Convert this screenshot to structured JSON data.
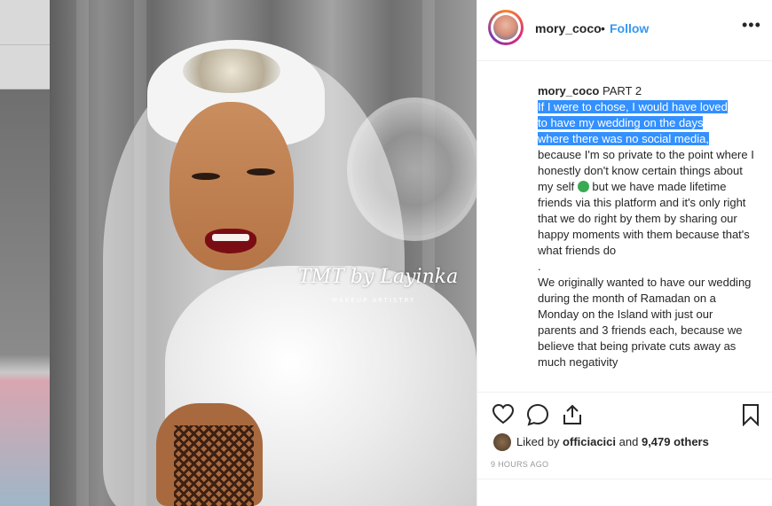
{
  "post": {
    "username": "mory_coco",
    "separator": "•",
    "follow_label": "Follow",
    "more_label": "•••",
    "caption": {
      "username": "mory_coco",
      "part_label": "PART 2",
      "highlighted_lines": [
        "If I were to chose, I would have loved",
        "to have my wedding on the days",
        "where there was no social media,"
      ],
      "line_1": "because I'm so private to the point where I honestly don't know certain things about my self",
      "line_1_after_emoji": "but we have made lifetime friends via this platform and it's only right that we do right by them by sharing our happy moments with them because that's what friends do",
      "dot": ".",
      "line_2": "We originally wanted to have our wedding during the month of Ramadan on a Monday on the Island with just our parents and 3 friends each, because we believe that being private cuts away as much negativity"
    },
    "photo": {
      "watermark": "TMT by Layinka",
      "watermark_sub": "MAKEUP ARTISTRY"
    },
    "likes": {
      "prefix": "Liked by",
      "liker": "officiacici",
      "conjunction": "and",
      "others": "9,479 others"
    },
    "timestamp": "9 HOURS AGO"
  },
  "icons": {
    "like": "heart-icon",
    "comment": "comment-icon",
    "share": "share-icon",
    "save": "bookmark-icon",
    "emoji": "crying-face-emoji-icon"
  },
  "colors": {
    "link_blue": "#3897f0",
    "selection": "#3390ff",
    "text": "#262626",
    "muted": "#999999"
  }
}
